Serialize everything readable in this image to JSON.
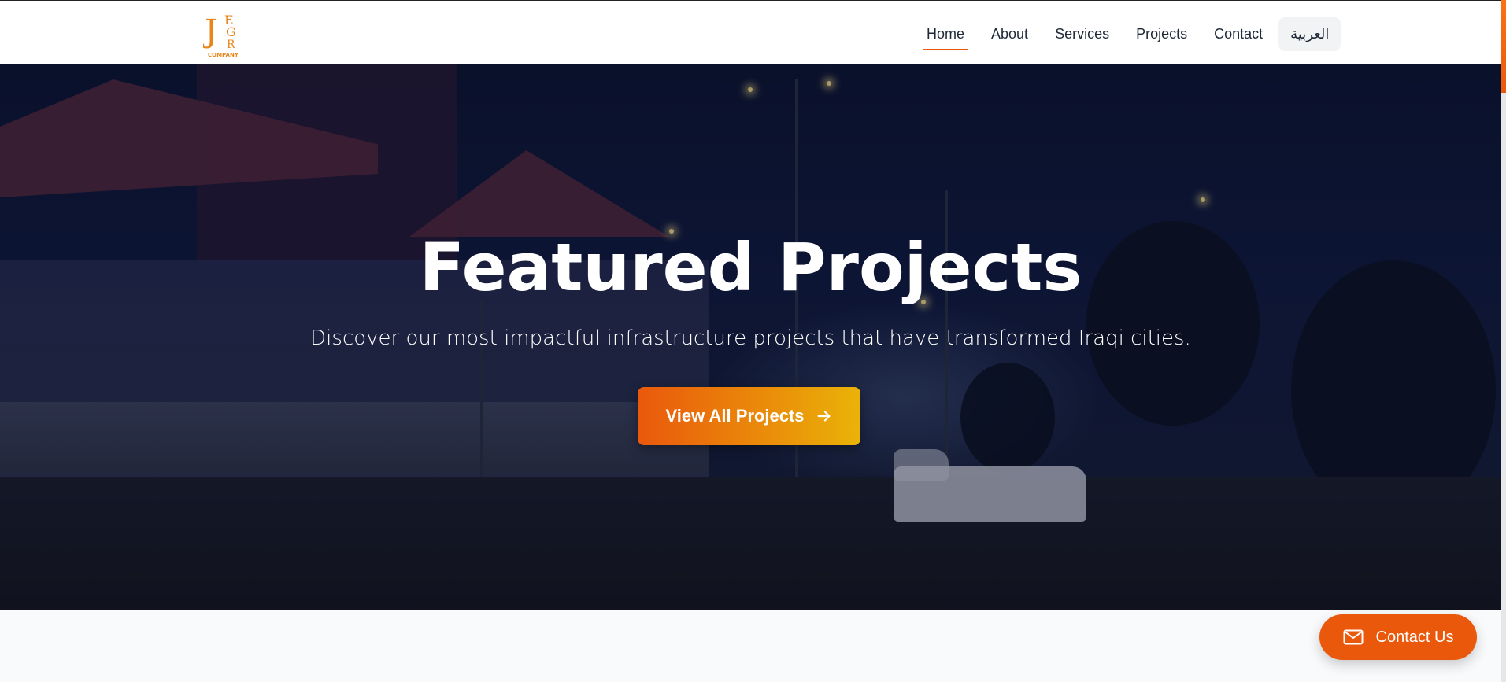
{
  "header": {
    "logo": {
      "letters": [
        "J",
        "E",
        "G",
        "R"
      ],
      "company": "COMPANY",
      "color": "#e8861a"
    },
    "nav": [
      {
        "label": "Home",
        "active": true
      },
      {
        "label": "About",
        "active": false
      },
      {
        "label": "Services",
        "active": false
      },
      {
        "label": "Projects",
        "active": false
      },
      {
        "label": "Contact",
        "active": false
      }
    ],
    "language_button": "العربية"
  },
  "hero": {
    "title": "Featured Projects",
    "subtitle": "Discover our most impactful infrastructure projects that have transformed Iraqi cities.",
    "cta_label": "View All Projects",
    "cta_icon": "arrow-right-icon"
  },
  "floating_contact": {
    "label": "Contact Us",
    "icon": "mail-icon"
  },
  "colors": {
    "accent": "#ea580c",
    "accent_end": "#eab308"
  }
}
